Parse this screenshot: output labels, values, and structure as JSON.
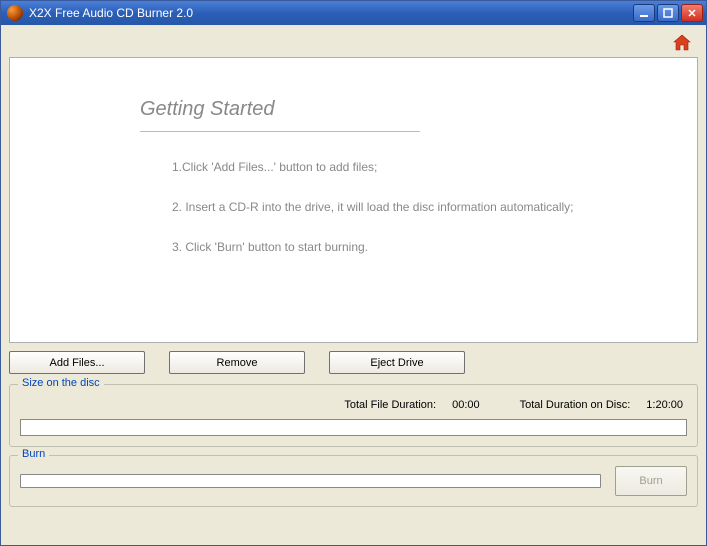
{
  "titlebar": {
    "title": "X2X Free Audio CD Burner 2.0"
  },
  "content": {
    "heading": "Getting Started",
    "steps": [
      "1.Click 'Add Files...' button to add files;",
      "2. Insert a CD-R into the drive, it will load the disc information automatically;",
      "3. Click 'Burn' button to start burning."
    ]
  },
  "buttons": {
    "add_files": "Add Files...",
    "remove": "Remove",
    "eject": "Eject Drive",
    "burn": "Burn"
  },
  "size_panel": {
    "legend": "Size on the disc",
    "file_duration_label": "Total File Duration:",
    "file_duration_value": "00:00",
    "disc_duration_label": "Total Duration on Disc:",
    "disc_duration_value": "1:20:00"
  },
  "burn_panel": {
    "legend": "Burn"
  }
}
